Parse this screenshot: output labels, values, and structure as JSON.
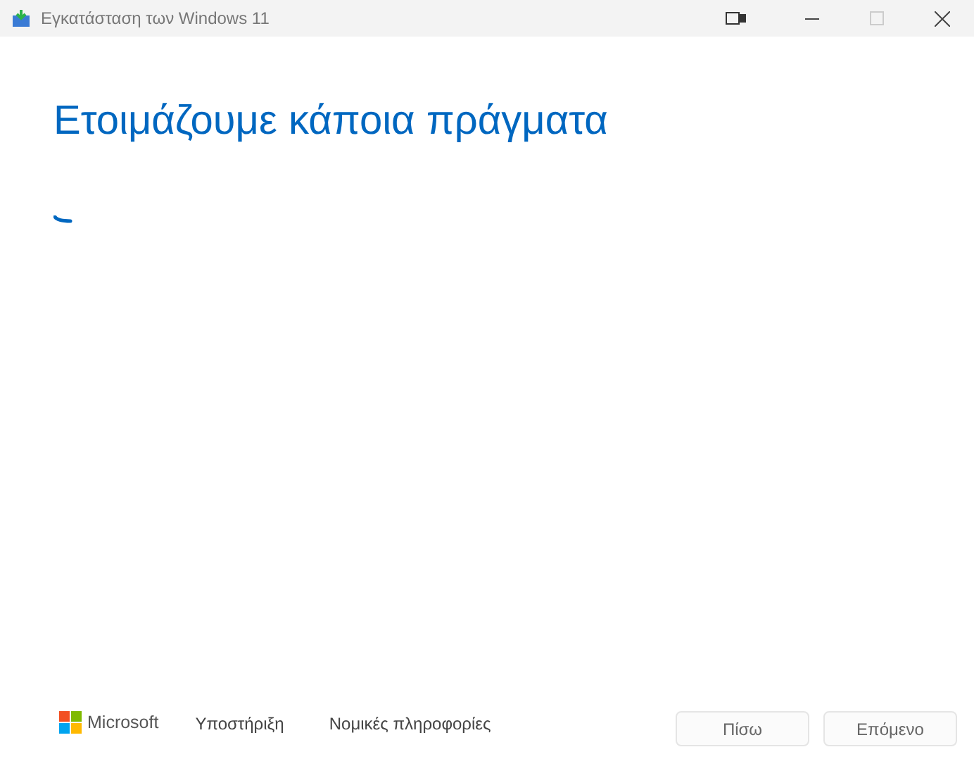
{
  "window": {
    "title": "Εγκατάσταση των Windows 11"
  },
  "heading": "Ετοιμάζουμε κάποια πράγματα",
  "footer": {
    "brand": "Microsoft",
    "links": [
      "Υποστήριξη",
      "Νομικές πληροφορίες"
    ]
  },
  "buttons": [
    {
      "label": "Πίσω",
      "disabled": true
    },
    {
      "label": "Επόμενο",
      "disabled": true
    }
  ]
}
